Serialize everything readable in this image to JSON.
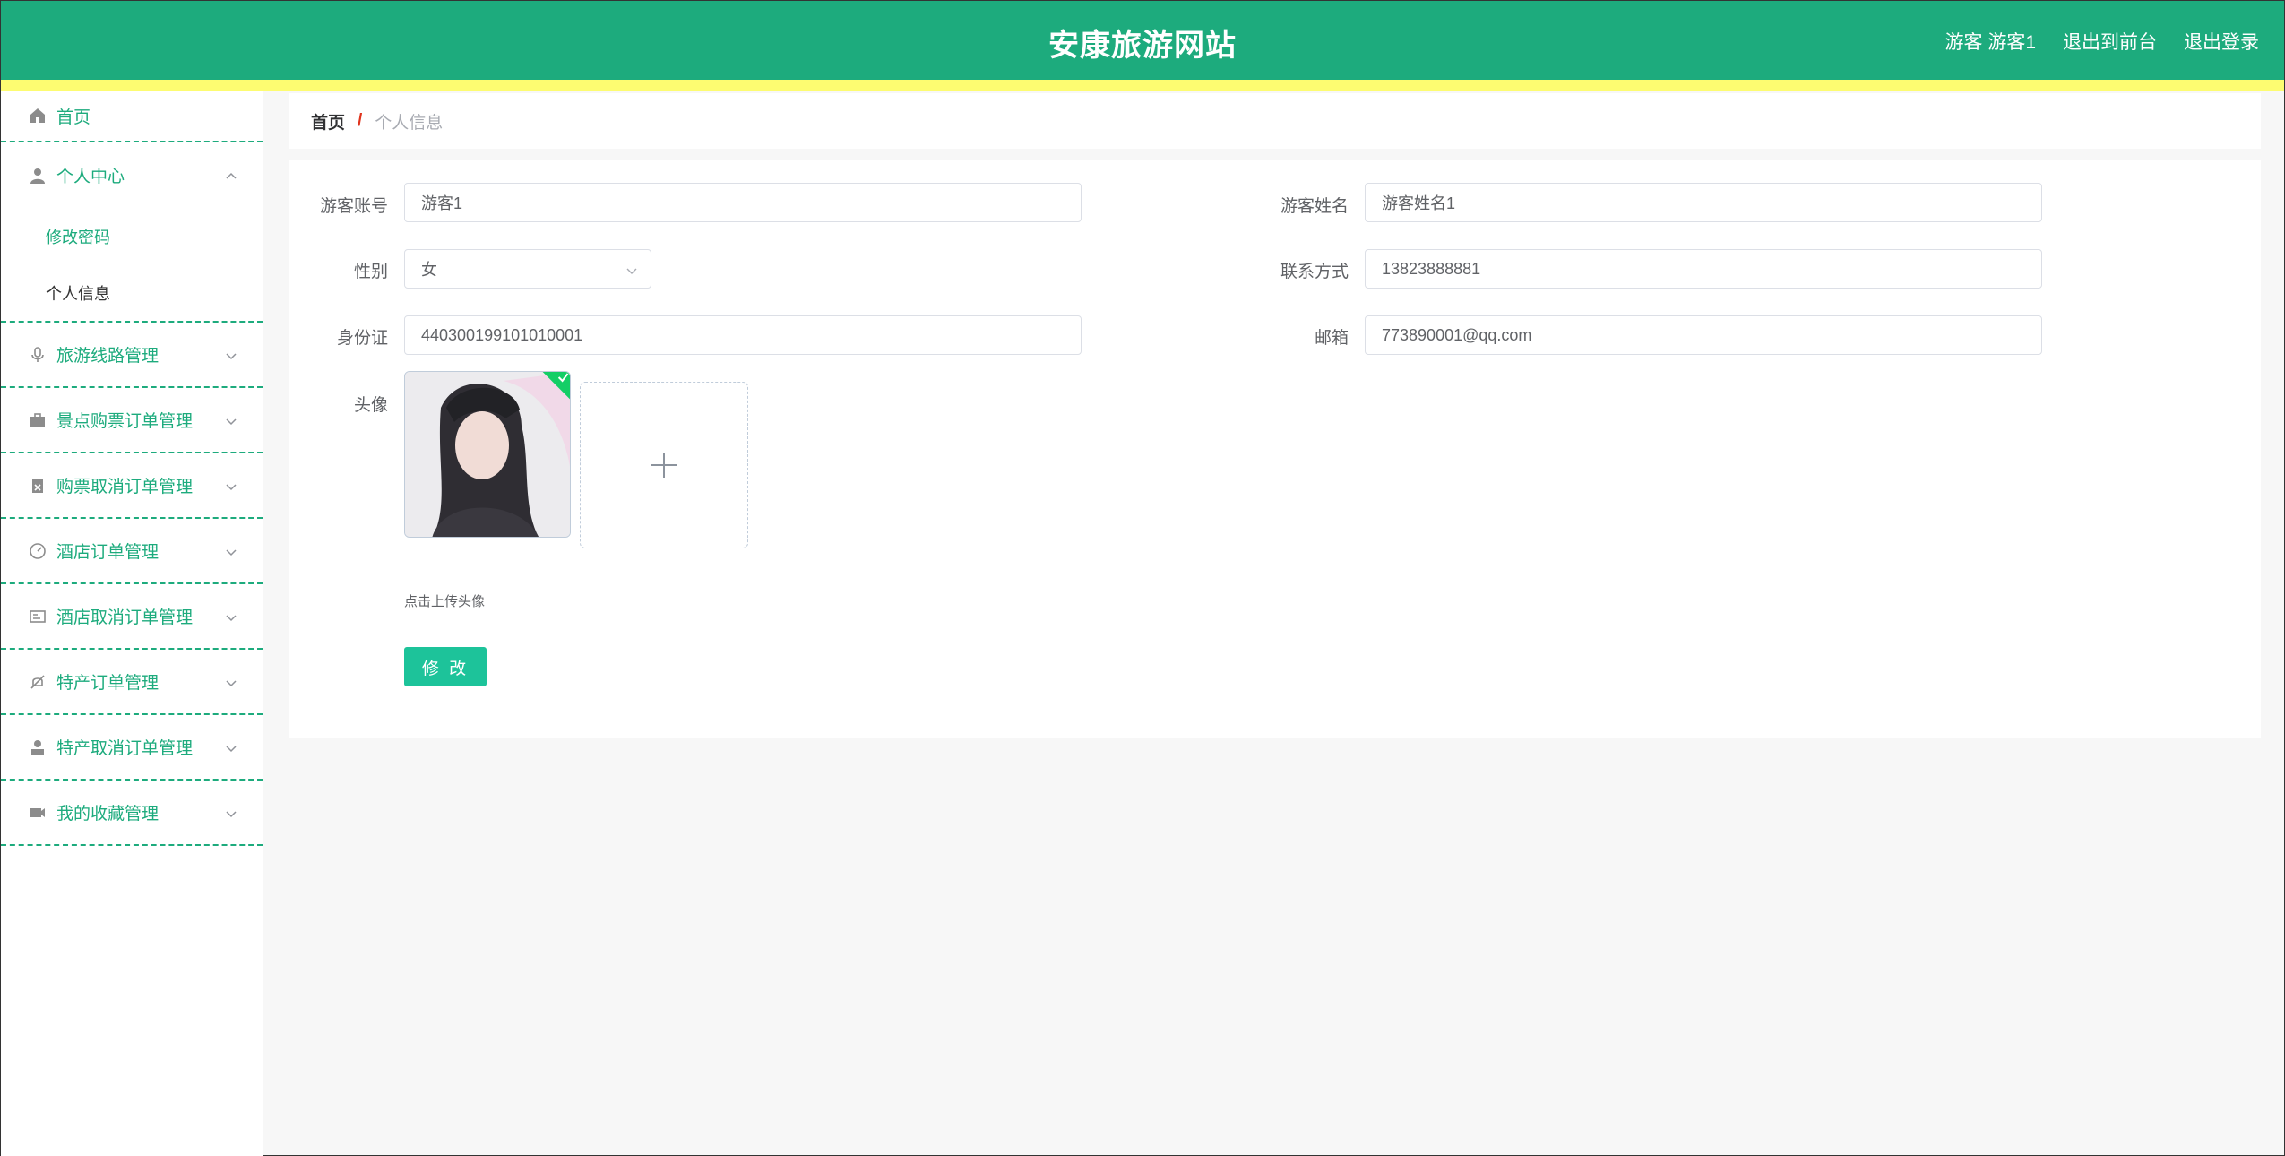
{
  "header": {
    "title": "安康旅游网站",
    "user": "游客 游客1",
    "to_front": "退出到前台",
    "logout": "退出登录"
  },
  "sidebar": {
    "items": [
      {
        "label": "首页",
        "icon": "home-icon"
      },
      {
        "label": "个人中心",
        "icon": "user-icon",
        "expanded": true,
        "children": [
          {
            "label": "修改密码"
          },
          {
            "label": "个人信息",
            "active": true
          }
        ]
      },
      {
        "label": "旅游线路管理",
        "icon": "microphone-icon"
      },
      {
        "label": "景点购票订单管理",
        "icon": "briefcase-icon"
      },
      {
        "label": "购票取消订单管理",
        "icon": "clipboard-icon"
      },
      {
        "label": "酒店订单管理",
        "icon": "dashboard-icon"
      },
      {
        "label": "酒店取消订单管理",
        "icon": "id-card-icon"
      },
      {
        "label": "特产订单管理",
        "icon": "bell-off-icon"
      },
      {
        "label": "特产取消订单管理",
        "icon": "user-solid-icon"
      },
      {
        "label": "我的收藏管理",
        "icon": "camera-icon"
      }
    ]
  },
  "breadcrumb": {
    "home": "首页",
    "separator": "/",
    "current": "个人信息"
  },
  "form": {
    "account_label": "游客账号",
    "account_value": "游客1",
    "name_label": "游客姓名",
    "name_value": "游客姓名1",
    "gender_label": "性别",
    "gender_value": "女",
    "phone_label": "联系方式",
    "phone_value": "13823888881",
    "id_label": "身份证",
    "id_value": "440300199101010001",
    "email_label": "邮箱",
    "email_value": "773890001@qq.com",
    "avatar_label": "头像",
    "upload_tip": "点击上传头像",
    "submit": "修 改"
  },
  "colors": {
    "primary": "#1dab7d",
    "stripe": "#fdfc71",
    "button": "#1dc39a"
  }
}
